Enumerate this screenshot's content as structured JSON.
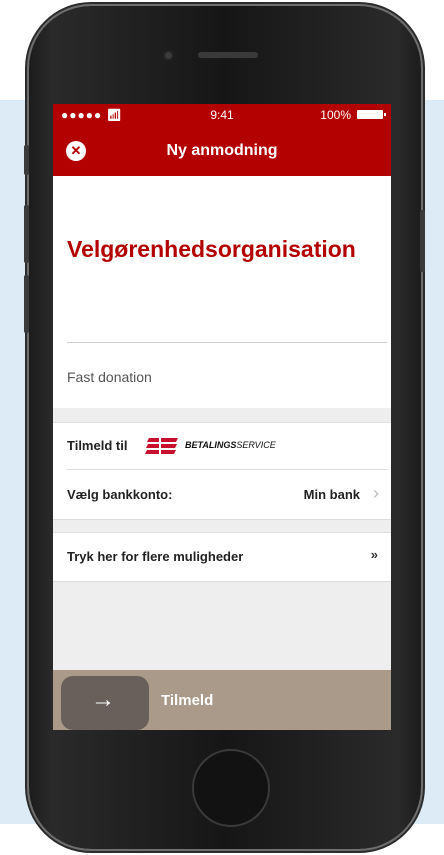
{
  "status_bar": {
    "signal": "●●●●● ",
    "wifi_icon": "wifi-icon",
    "time": "9:41",
    "battery": "100%"
  },
  "nav": {
    "title": "Ny anmodning",
    "close_icon": "close-icon"
  },
  "organization": {
    "name": "Velgørenhedsorganisation",
    "subtitle": "Fast donation"
  },
  "subscribe": {
    "label": "Tilmeld til",
    "logo_text_bold": "BETALINGS",
    "logo_text_light": "SERVICE"
  },
  "bank": {
    "label": "Vælg bankkonto:",
    "value": "Min bank"
  },
  "more_options": {
    "label": "Tryk her for flere muligheder"
  },
  "action": {
    "label": "Tilmeld"
  },
  "colors": {
    "brand_red": "#b30000",
    "action_bar": "#a99a89",
    "action_handle": "#6a605b"
  }
}
